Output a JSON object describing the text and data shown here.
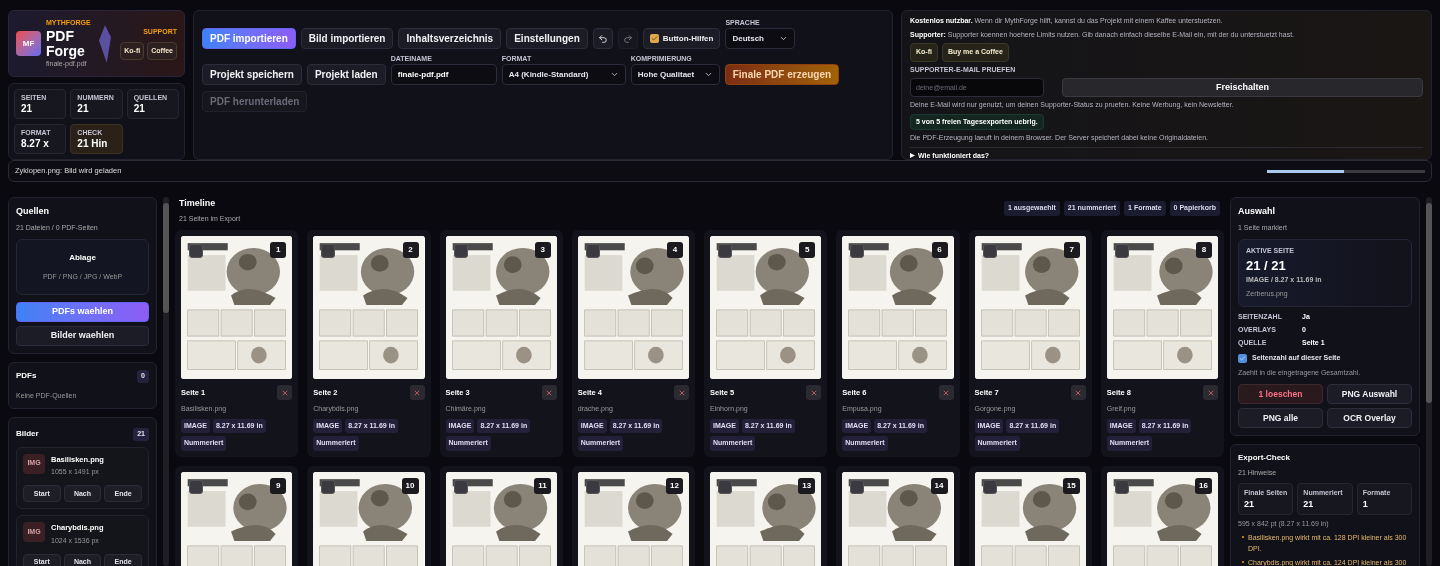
{
  "brand": {
    "eyebrow": "MYTHFORGE",
    "logo": "MF",
    "title": "PDF Forge",
    "file": "finale-pdf.pdf",
    "support_label": "SUPPORT",
    "support_buttons": [
      "Ko-fi",
      "Coffee"
    ]
  },
  "stats": [
    {
      "label": "SEITEN",
      "value": "21",
      "kind": "plain"
    },
    {
      "label": "NUMMERN",
      "value": "21",
      "kind": "plain"
    },
    {
      "label": "QUELLEN",
      "value": "21",
      "kind": "plain"
    },
    {
      "label": "FORMAT",
      "value": "8.27 x",
      "kind": "plain"
    },
    {
      "label": "CHECK",
      "value": "21 Hin",
      "kind": "warning"
    }
  ],
  "toolbar": {
    "row1": [
      {
        "label": "PDF importieren",
        "kind": "primary"
      },
      {
        "label": "Bild importieren",
        "kind": "default"
      },
      {
        "label": "Inhaltsverzeichnis",
        "kind": "default"
      },
      {
        "label": "Einstellungen",
        "kind": "default"
      }
    ],
    "undo": {
      "disabled": false
    },
    "redo": {
      "disabled": true
    },
    "button_help": {
      "label": "Button-Hilfen",
      "checked": true
    },
    "language": {
      "label": "SPRACHE",
      "value": "Deutsch"
    },
    "row2": [
      {
        "label": "Projekt speichern"
      },
      {
        "label": "Projekt laden"
      }
    ],
    "filename": {
      "label": "DATEINAME",
      "value": "finale-pdf.pdf"
    },
    "format": {
      "label": "FORMAT",
      "value": "A4 (Kindle-Standard)"
    },
    "compression": {
      "label": "KOMPRIMIERUNG",
      "value": "Hohe Qualitaet"
    },
    "generate": {
      "label": "Finale PDF erzeugen"
    },
    "download": {
      "label": "PDF herunterladen",
      "disabled": true
    }
  },
  "support": {
    "intro": "**Kostenlos nutzbar.** Wenn dir MythForge hilft, kannst du das Projekt mit einem Kaffee unterstuetzen.",
    "supporter": "**Supporter:** Supporter koennen hoehere Limits nutzen. Gib danach einfach dieselbe E-Mail ein, mit der du unterstuetzt hast.",
    "buttons": [
      "Ko-fi",
      "Buy me a Coffee"
    ],
    "email_label": "SUPPORTER-E-MAIL PRUEFEN",
    "email_placeholder": "deine@email.de",
    "unlock": "Freischalten",
    "email_note": "Deine E-Mail wird nur genutzt, um deinen Supporter-Status zu pruefen. Keine Werbung, kein Newsletter.",
    "quota": "5 von 5 freien Tagesexporten uebrig.",
    "privacy": "Die PDF-Erzeugung laeuft in deinem Browser. Der Server speichert dabei keine Originaldateien.",
    "details": {
      "label": "Wie funktioniert das?",
      "expanded": false
    }
  },
  "status": {
    "message": "Zyklopen.png: Bild wird geladen",
    "level": 0.49
  },
  "sources": {
    "title": "Quellen",
    "subtitle": "21 Dateien / 0 PDF-Seiten",
    "drop_title": "Ablage",
    "drop_hint": "PDF / PNG / JPG / WebP",
    "primary": "PDFs waehlen",
    "secondary": "Bilder waehlen"
  },
  "pdfs": {
    "title": "PDFs",
    "count": "0",
    "empty": "Keine PDF-Quellen"
  },
  "images": {
    "title": "Bilder",
    "count": "21",
    "items": [
      {
        "thumb": "IMG",
        "name": "Basilisken.png",
        "size": "1055 x 1491 px",
        "actions": [
          "Start",
          "Nach",
          "Ende"
        ]
      },
      {
        "thumb": "IMG",
        "name": "Charybdis.png",
        "size": "1024 x 1536 px",
        "actions": [
          "Start",
          "Nach",
          "Ende"
        ]
      }
    ]
  },
  "timeline": {
    "title": "Timeline",
    "subtitle": "21 Seiten im Export",
    "chips": [
      "1 ausgewaehlt",
      "21 nummeriert",
      "1 Formate",
      "0 Papierkorb"
    ],
    "pages": [
      {
        "number": "1",
        "title": "Seite 1",
        "file": "Basilisken.png",
        "selected": false,
        "tags": [
          "IMAGE",
          "8.27 x 11.69 in",
          "Nummeriert"
        ]
      },
      {
        "number": "2",
        "title": "Seite 2",
        "file": "Charybdis.png",
        "selected": false,
        "tags": [
          "IMAGE",
          "8.27 x 11.69 in",
          "Nummeriert"
        ]
      },
      {
        "number": "3",
        "title": "Seite 3",
        "file": "Chimäre.png",
        "selected": false,
        "tags": [
          "IMAGE",
          "8.27 x 11.69 in",
          "Nummeriert"
        ]
      },
      {
        "number": "4",
        "title": "Seite 4",
        "file": "drache.png",
        "selected": false,
        "tags": [
          "IMAGE",
          "8.27 x 11.69 in",
          "Nummeriert"
        ]
      },
      {
        "number": "5",
        "title": "Seite 5",
        "file": "Einhorn.png",
        "selected": false,
        "tags": [
          "IMAGE",
          "8.27 x 11.69 in",
          "Nummeriert"
        ]
      },
      {
        "number": "6",
        "title": "Seite 6",
        "file": "Empusa.png",
        "selected": false,
        "tags": [
          "IMAGE",
          "8.27 x 11.69 in",
          "Nummeriert"
        ]
      },
      {
        "number": "7",
        "title": "Seite 7",
        "file": "Gorgone.png",
        "selected": false,
        "tags": [
          "IMAGE",
          "8.27 x 11.69 in",
          "Nummeriert"
        ]
      },
      {
        "number": "8",
        "title": "Seite 8",
        "file": "Greif.png",
        "selected": false,
        "tags": [
          "IMAGE",
          "8.27 x 11.69 in",
          "Nummeriert"
        ]
      }
    ],
    "more_pages": [
      {
        "number": "9",
        "selected": false
      },
      {
        "number": "10",
        "selected": false
      },
      {
        "number": "11",
        "selected": false
      },
      {
        "number": "12",
        "selected": false
      },
      {
        "number": "13",
        "selected": false
      },
      {
        "number": "14",
        "selected": false
      },
      {
        "number": "15",
        "selected": false
      },
      {
        "number": "16",
        "selected": false
      }
    ]
  },
  "selection": {
    "title": "Auswahl",
    "subtitle": "1 Seite markiert",
    "active_label": "AKTIVE SEITE",
    "active_value": "21 / 21",
    "active_meta": "IMAGE / 8.27 x 11.69 in",
    "active_file": "Zerberus.png",
    "props": [
      {
        "label": "SEITENZAHL",
        "value": "Ja"
      },
      {
        "label": "OVERLAYS",
        "value": "0"
      },
      {
        "label": "QUELLE",
        "value": "Seite 1"
      }
    ],
    "checkbox": {
      "label": "Seitenzahl auf dieser Seite",
      "checked": true
    },
    "hint": "Zaehlt in die eingetragene Gesamtzahl.",
    "actions": [
      {
        "label": "1 loeschen",
        "kind": "danger"
      },
      {
        "label": "PNG Auswahl",
        "kind": "default"
      },
      {
        "label": "PNG alle",
        "kind": "default"
      },
      {
        "label": "OCR Overlay",
        "kind": "default"
      }
    ]
  },
  "export_check": {
    "title": "Export-Check",
    "subtitle": "21 Hinweise",
    "stats": [
      {
        "label": "Finale Seiten",
        "value": "21"
      },
      {
        "label": "Nummeriert",
        "value": "21"
      },
      {
        "label": "Formate",
        "value": "1"
      }
    ],
    "dims": "595 x 842 pt (8.27 x 11.69 in)",
    "warnings": [
      "Basilisken.png wirkt mit ca. 128 DPI kleiner als 300 DPI.",
      "Charybdis.png wirkt mit ca. 124 DPI kleiner als 300"
    ]
  }
}
